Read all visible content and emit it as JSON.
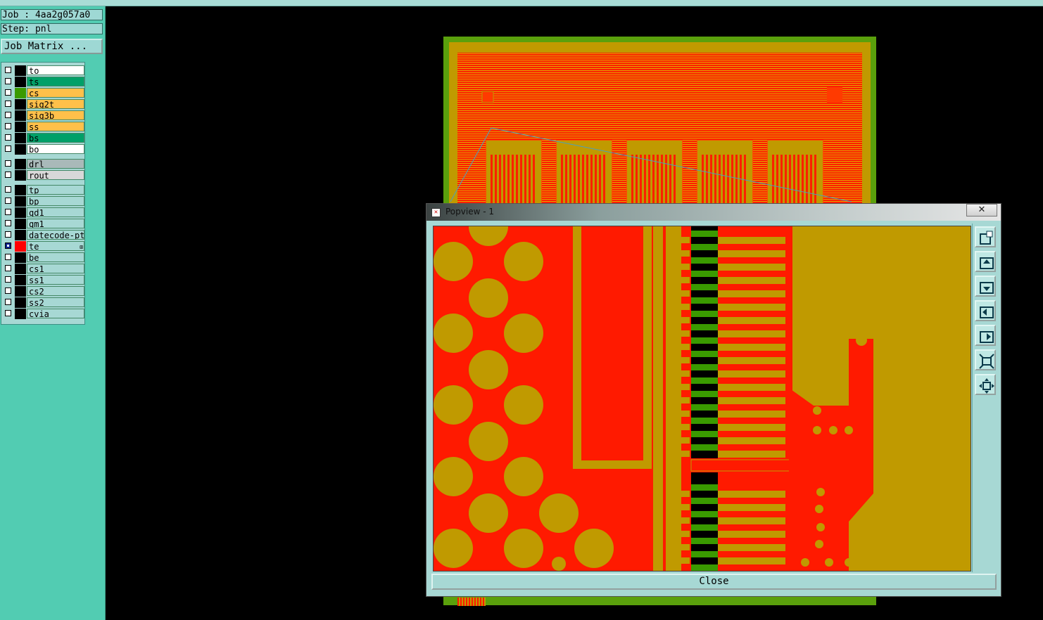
{
  "job": {
    "label": "Job : 4aa2g057a0",
    "step": "Step: pnl"
  },
  "job_matrix_button": "Job Matrix ...",
  "layers": [
    {
      "name": "to",
      "color": "#ffffff",
      "swatch": "#000000",
      "checked": false
    },
    {
      "name": "ts",
      "color": "#00a068",
      "swatch": "#000000",
      "checked": false
    },
    {
      "name": "cs",
      "color": "#ffc04a",
      "swatch": "#3a9a00",
      "checked": false
    },
    {
      "name": "sig2t",
      "color": "#ffc04a",
      "swatch": "#000000",
      "checked": false
    },
    {
      "name": "sig3b",
      "color": "#ffc04a",
      "swatch": "#000000",
      "checked": false
    },
    {
      "name": "ss",
      "color": "#ffc04a",
      "swatch": "#000000",
      "checked": false
    },
    {
      "name": "bs",
      "color": "#00a068",
      "swatch": "#000000",
      "checked": false
    },
    {
      "name": "bo",
      "color": "#ffffff",
      "swatch": "#000000",
      "checked": false
    },
    {
      "name": "drl",
      "color": "#a9b9b9",
      "swatch": "#000000",
      "checked": false
    },
    {
      "name": "rout",
      "color": "#d8d8d8",
      "swatch": "#000000",
      "checked": false
    },
    {
      "name": "tp",
      "color": "#a7d8d4",
      "swatch": "#000000",
      "checked": false
    },
    {
      "name": "bp",
      "color": "#a7d8d4",
      "swatch": "#000000",
      "checked": false
    },
    {
      "name": "qd1",
      "color": "#a7d8d4",
      "swatch": "#000000",
      "checked": false
    },
    {
      "name": "qm1",
      "color": "#a7d8d4",
      "swatch": "#000000",
      "checked": false
    },
    {
      "name": "datecode-pte",
      "color": "#a7d8d4",
      "swatch": "#000000",
      "checked": false
    },
    {
      "name": "te",
      "color": "#a7d8d4",
      "swatch": "#ff0000",
      "checked": true,
      "marker": "⊞"
    },
    {
      "name": "be",
      "color": "#a7d8d4",
      "swatch": "#000000",
      "checked": false
    },
    {
      "name": "cs1",
      "color": "#a7d8d4",
      "swatch": "#000000",
      "checked": false
    },
    {
      "name": "ss1",
      "color": "#a7d8d4",
      "swatch": "#000000",
      "checked": false
    },
    {
      "name": "cs2",
      "color": "#a7d8d4",
      "swatch": "#000000",
      "checked": false
    },
    {
      "name": "ss2",
      "color": "#a7d8d4",
      "swatch": "#000000",
      "checked": false
    },
    {
      "name": "cvia",
      "color": "#a7d8d4",
      "swatch": "#000000",
      "checked": false
    }
  ],
  "popview": {
    "title": "Popview - 1",
    "close_x": "✕",
    "close_button": "Close",
    "toolbar_icons": [
      "zoom-window-icon",
      "pan-up-icon",
      "pan-down-icon",
      "pan-left-icon",
      "pan-right-icon",
      "zoom-out-icon",
      "zoom-fit-icon"
    ]
  },
  "colors": {
    "copper": "#ff1a00",
    "substrate": "#c09a00",
    "mask": "#5aa00c",
    "panel": "#52ccb2"
  }
}
